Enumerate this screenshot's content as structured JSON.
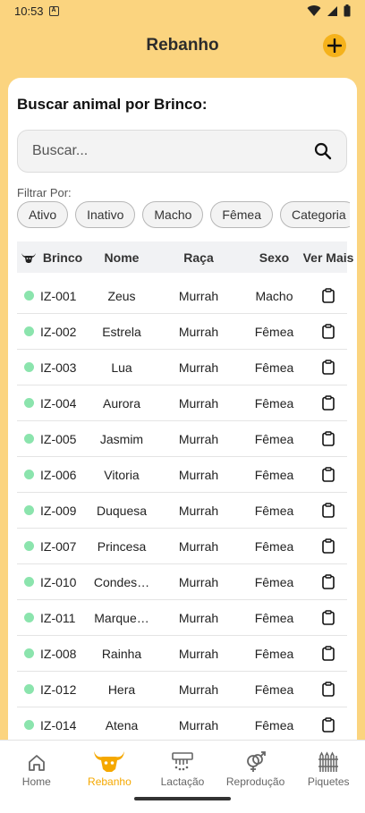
{
  "status_bar": {
    "time": "10:53",
    "sim_label": "A"
  },
  "app_bar": {
    "title": "Rebanho"
  },
  "search": {
    "title": "Buscar animal por Brinco:",
    "placeholder": "Buscar..."
  },
  "filters": {
    "label": "Filtrar Por:",
    "chips": [
      "Ativo",
      "Inativo",
      "Macho",
      "Fêmea",
      "Categoria"
    ]
  },
  "table": {
    "headers": {
      "brinco": "Brinco",
      "nome": "Nome",
      "raca": "Raça",
      "sexo": "Sexo",
      "ver_mais": "Ver Mais"
    },
    "rows": [
      {
        "brinco": "IZ-001",
        "nome": "Zeus",
        "raca": "Murrah",
        "sexo": "Macho"
      },
      {
        "brinco": "IZ-002",
        "nome": "Estrela",
        "raca": "Murrah",
        "sexo": "Fêmea"
      },
      {
        "brinco": "IZ-003",
        "nome": "Lua",
        "raca": "Murrah",
        "sexo": "Fêmea"
      },
      {
        "brinco": "IZ-004",
        "nome": "Aurora",
        "raca": "Murrah",
        "sexo": "Fêmea"
      },
      {
        "brinco": "IZ-005",
        "nome": "Jasmim",
        "raca": "Murrah",
        "sexo": "Fêmea"
      },
      {
        "brinco": "IZ-006",
        "nome": "Vitoria",
        "raca": "Murrah",
        "sexo": "Fêmea"
      },
      {
        "brinco": "IZ-009",
        "nome": "Duquesa",
        "raca": "Murrah",
        "sexo": "Fêmea"
      },
      {
        "brinco": "IZ-007",
        "nome": "Princesa",
        "raca": "Murrah",
        "sexo": "Fêmea"
      },
      {
        "brinco": "IZ-010",
        "nome": "Condes…",
        "raca": "Murrah",
        "sexo": "Fêmea"
      },
      {
        "brinco": "IZ-011",
        "nome": "Marque…",
        "raca": "Murrah",
        "sexo": "Fêmea"
      },
      {
        "brinco": "IZ-008",
        "nome": "Rainha",
        "raca": "Murrah",
        "sexo": "Fêmea"
      },
      {
        "brinco": "IZ-012",
        "nome": "Hera",
        "raca": "Murrah",
        "sexo": "Fêmea"
      },
      {
        "brinco": "IZ-014",
        "nome": "Atena",
        "raca": "Murrah",
        "sexo": "Fêmea"
      }
    ]
  },
  "bottom_nav": {
    "items": [
      {
        "label": "Home",
        "icon": "home-icon",
        "active": false
      },
      {
        "label": "Rebanho",
        "icon": "buffalo-icon",
        "active": true
      },
      {
        "label": "Lactação",
        "icon": "milking-icon",
        "active": false
      },
      {
        "label": "Reprodução",
        "icon": "gender-icon",
        "active": false
      },
      {
        "label": "Piquetes",
        "icon": "fence-icon",
        "active": false
      }
    ]
  },
  "colors": {
    "header_bg": "#fbd47f",
    "accent": "#f5a800",
    "add_button": "#f5b21b",
    "active_dot": "#8be4ad"
  }
}
